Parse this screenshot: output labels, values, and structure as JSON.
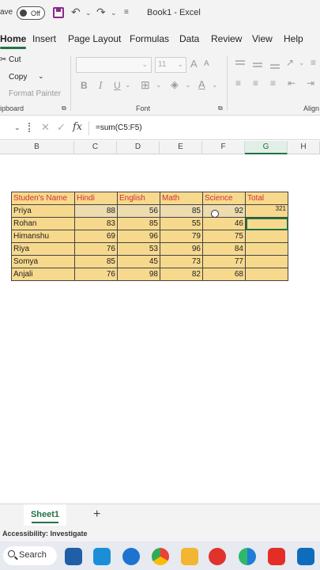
{
  "titlebar": {
    "autosave_label": "ave",
    "toggle_state": "Off",
    "title": "Book1 - Excel"
  },
  "tabs": [
    "Home",
    "Insert",
    "Page Layout",
    "Formulas",
    "Data",
    "Review",
    "View",
    "Help"
  ],
  "ribbon": {
    "clipboard": {
      "cut": "Cut",
      "copy": "Copy",
      "format_painter": "Format Painter",
      "group": "ipboard"
    },
    "font": {
      "size": "11",
      "bold": "B",
      "italic": "I",
      "underline": "U",
      "group": "Font",
      "grow": "A",
      "shrink": "A",
      "font_color": "A"
    },
    "alignment": {
      "group": "Align"
    }
  },
  "formula_bar": {
    "formula": "=sum(C5:F5)"
  },
  "columns": [
    "B",
    "C",
    "D",
    "E",
    "F",
    "G",
    "H"
  ],
  "selected_column": "G",
  "table": {
    "headers": [
      "Studen's Name",
      "Hindi",
      "English",
      "Math",
      "Science",
      "Total"
    ],
    "rows": [
      [
        "Priya",
        "88",
        "56",
        "85",
        "92",
        "321"
      ],
      [
        "Rohan",
        "83",
        "85",
        "55",
        "46",
        ""
      ],
      [
        "Himanshu",
        "69",
        "96",
        "79",
        "75",
        ""
      ],
      [
        "Riya",
        "76",
        "53",
        "96",
        "84",
        ""
      ],
      [
        "Somya",
        "85",
        "45",
        "73",
        "77",
        ""
      ],
      [
        "Anjali",
        "76",
        "98",
        "82",
        "68",
        ""
      ]
    ]
  },
  "sheet": {
    "tab": "Sheet1",
    "add": "+"
  },
  "status": {
    "accessibility": "Accessibility: Investigate"
  },
  "taskbar": {
    "search": "Search"
  },
  "colors": {
    "accent": "#217346",
    "table_fill": "#f7d98e",
    "header_text": "#d32f2f"
  }
}
